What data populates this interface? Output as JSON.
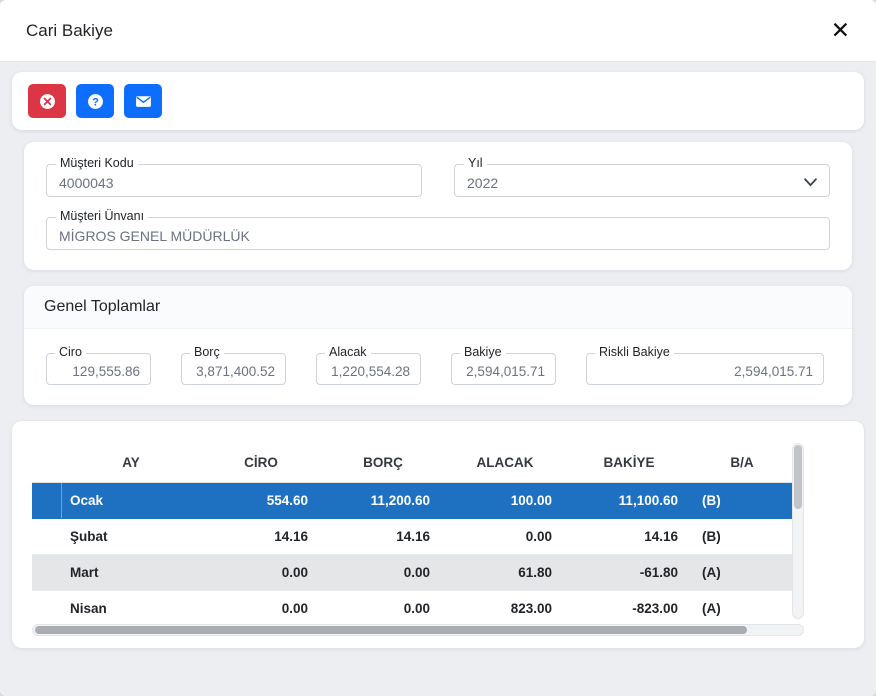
{
  "modal": {
    "title": "Cari Bakiye",
    "close_glyph": "✕"
  },
  "toolbar": {
    "buttons": [
      {
        "id": "cancel",
        "icon": "x-circle-icon"
      },
      {
        "id": "help",
        "icon": "question-circle-icon"
      },
      {
        "id": "mail",
        "icon": "envelope-icon"
      }
    ]
  },
  "form": {
    "musteri_kodu": {
      "label": "Müşteri Kodu",
      "value": "4000043"
    },
    "yil": {
      "label": "Yıl",
      "value": "2022"
    },
    "musteri_unvani": {
      "label": "Müşteri Ünvanı",
      "value": "MİGROS GENEL MÜDÜRLÜK"
    }
  },
  "totals": {
    "title": "Genel Toplamlar",
    "fields": [
      {
        "label": "Ciro",
        "value": "129,555.86"
      },
      {
        "label": "Borç",
        "value": "3,871,400.52"
      },
      {
        "label": "Alacak",
        "value": "1,220,554.28"
      },
      {
        "label": "Bakiye",
        "value": "2,594,015.71"
      },
      {
        "label": "Riskli Bakiye",
        "value": "2,594,015.71"
      }
    ]
  },
  "table": {
    "headers": [
      "AY",
      "CİRO",
      "BORÇ",
      "ALACAK",
      "BAKİYE",
      "B/A"
    ],
    "rows": [
      {
        "ay": "Ocak",
        "ciro": "554.60",
        "borc": "11,200.60",
        "alacak": "100.00",
        "bakiye": "11,100.60",
        "ba": "(B)",
        "selected": true
      },
      {
        "ay": "Şubat",
        "ciro": "14.16",
        "borc": "14.16",
        "alacak": "0.00",
        "bakiye": "14.16",
        "ba": "(B)",
        "selected": false
      },
      {
        "ay": "Mart",
        "ciro": "0.00",
        "borc": "0.00",
        "alacak": "61.80",
        "bakiye": "-61.80",
        "ba": "(A)",
        "selected": false
      },
      {
        "ay": "Nisan",
        "ciro": "0.00",
        "borc": "0.00",
        "alacak": "823.00",
        "bakiye": "-823.00",
        "ba": "(A)",
        "selected": false
      }
    ]
  },
  "colors": {
    "danger": "#dc3545",
    "primary": "#0d6efd",
    "selected_row": "#1e70c1",
    "striped_row": "#e4e6e8",
    "body_bg": "#eceef2"
  }
}
